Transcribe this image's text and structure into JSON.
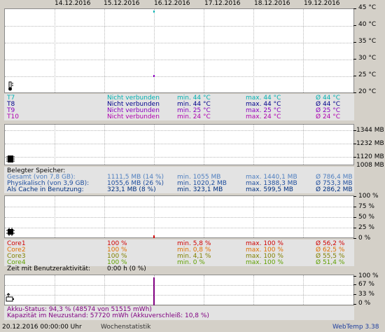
{
  "dates": [
    "14.12.2016",
    "15.12.2016",
    "16.12.2016",
    "17.12.2016",
    "18.12.2016",
    "19.12.2016"
  ],
  "temp_chart": {
    "y_labels": [
      "45 °C",
      "40 °C",
      "35 °C",
      "30 °C",
      "25 °C",
      "20 °C"
    ],
    "rows": [
      {
        "name": "T7",
        "status": "Nicht verbunden",
        "min": "min. 44 °C",
        "max": "max. 44 °C",
        "avg": "Ø 44 °C",
        "color": "#00b0b0"
      },
      {
        "name": "T8",
        "status": "Nicht verbunden",
        "min": "min. 44 °C",
        "max": "max. 44 °C",
        "avg": "Ø 44 °C",
        "color": "#00008b"
      },
      {
        "name": "T9",
        "status": "Nicht verbunden",
        "min": "min. 25 °C",
        "max": "max. 25 °C",
        "avg": "Ø 25 °C",
        "color": "#8b00c0"
      },
      {
        "name": "T10",
        "status": "Nicht verbunden",
        "min": "min. 24 °C",
        "max": "max. 24 °C",
        "avg": "Ø 24 °C",
        "color": "#b000b0"
      }
    ]
  },
  "mem_chart": {
    "y_labels": [
      "1344 MB",
      "1232 MB",
      "1120 MB",
      "1008 MB"
    ],
    "title": "Belegter Speicher:",
    "rows": [
      {
        "name": "Gesamt (von 7,8 GB):",
        "cur": "1111,5 MB (14 %)",
        "min": "min. 1055 MB",
        "max": "max. 1440,1 MB",
        "avg": "Ø 786,4 MB",
        "color": "#4f7fc0"
      },
      {
        "name": "Physikalisch (von 3,9 GB):",
        "cur": "1055,6 MB (26 %)",
        "min": "min. 1020,2 MB",
        "max": "max. 1388,3 MB",
        "avg": "Ø 753,3 MB",
        "color": "#1f4f9f"
      },
      {
        "name": "Als Cache in Benutzung:",
        "cur": "323,1 MB (8 %)",
        "min": "min. 323,1 MB",
        "max": "max. 599,5 MB",
        "avg": "Ø 286,2 MB",
        "color": "#003080"
      }
    ]
  },
  "cpu_chart": {
    "y_labels": [
      "100 %",
      "75 %",
      "50 %",
      "25 %",
      "0 %"
    ],
    "rows": [
      {
        "name": "Core1",
        "cur": "100 %",
        "min": "min. 5,8 %",
        "max": "max. 100 %",
        "avg": "Ø 56,2 %",
        "color": "#d00000"
      },
      {
        "name": "Core2",
        "cur": "100 %",
        "min": "min. 0,8 %",
        "max": "max. 100 %",
        "avg": "Ø 62,5 %",
        "color": "#e07000"
      },
      {
        "name": "Core3",
        "cur": "100 %",
        "min": "min. 4,1 %",
        "max": "max. 100 %",
        "avg": "Ø 55,5 %",
        "color": "#808000"
      },
      {
        "name": "Core4",
        "cur": "100 %",
        "min": "min. 0 %",
        "max": "max. 100 %",
        "avg": "Ø 51,4 %",
        "color": "#60a000"
      }
    ],
    "activity_label": "Zeit mit Benutzeraktivität:",
    "activity_value": "0:00 h (0 %)"
  },
  "battery_chart": {
    "y_labels": [
      "100 %",
      "67 %",
      "33 %",
      "0 %"
    ],
    "status": "Akku-Status: 94,3 % (48574 von 51515 mWh)",
    "capacity": "Kapazität im Neuzustand: 57720 mWh (Akkuverschleiß: 10,8 %)",
    "color": "#800080"
  },
  "footer": {
    "timestamp": "20.12.2016 00:00:00 Uhr",
    "mode": "Wochenstatistik",
    "app": "WebTemp 3.38"
  }
}
